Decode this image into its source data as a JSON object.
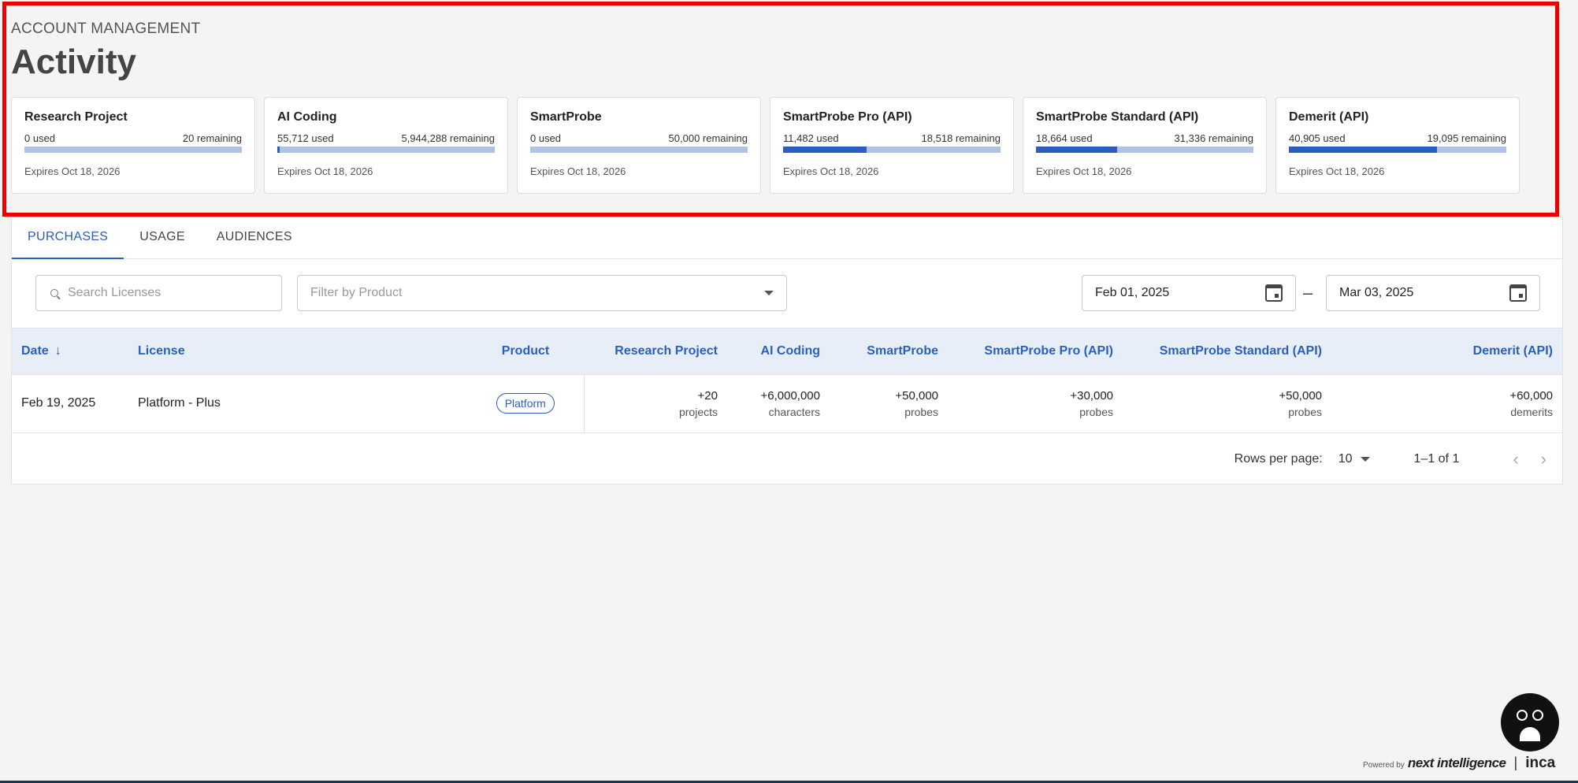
{
  "header": {
    "section": "ACCOUNT MANAGEMENT",
    "title": "Activity"
  },
  "cards": [
    {
      "title": "Research Project",
      "used": "0 used",
      "remaining": "20 remaining",
      "used_fraction": 0.0,
      "expiry": "Expires Oct 18, 2026"
    },
    {
      "title": "AI Coding",
      "used": "55,712 used",
      "remaining": "5,944,288 remaining",
      "used_fraction": 0.0093,
      "expiry": "Expires Oct 18, 2026"
    },
    {
      "title": "SmartProbe",
      "used": "0 used",
      "remaining": "50,000 remaining",
      "used_fraction": 0.0,
      "expiry": "Expires Oct 18, 2026"
    },
    {
      "title": "SmartProbe Pro (API)",
      "used": "11,482 used",
      "remaining": "18,518 remaining",
      "used_fraction": 0.3827,
      "expiry": "Expires Oct 18, 2026"
    },
    {
      "title": "SmartProbe Standard (API)",
      "used": "18,664 used",
      "remaining": "31,336 remaining",
      "used_fraction": 0.3733,
      "expiry": "Expires Oct 18, 2026"
    },
    {
      "title": "Demerit (API)",
      "used": "40,905 used",
      "remaining": "19,095 remaining",
      "used_fraction": 0.6818,
      "expiry": "Expires Oct 18, 2026"
    }
  ],
  "tabs": [
    "PURCHASES",
    "USAGE",
    "AUDIENCES"
  ],
  "filters": {
    "search_placeholder": "Search Licenses",
    "product_placeholder": "Filter by Product",
    "date_from": "Feb 01, 2025",
    "date_separator": "–",
    "date_to": "Mar 03, 2025"
  },
  "table": {
    "columns": [
      "Date",
      "License",
      "Product",
      "Research Project",
      "AI Coding",
      "SmartProbe",
      "SmartProbe Pro (API)",
      "SmartProbe Standard (API)",
      "Demerit (API)"
    ],
    "rows": [
      {
        "date": "Feb 19, 2025",
        "license": "Platform - Plus",
        "product": "Platform",
        "research_project": {
          "value": "+20",
          "unit": "projects"
        },
        "ai_coding": {
          "value": "+6,000,000",
          "unit": "characters"
        },
        "smartprobe": {
          "value": "+50,000",
          "unit": "probes"
        },
        "smartprobe_pro": {
          "value": "+30,000",
          "unit": "probes"
        },
        "smartprobe_standard": {
          "value": "+50,000",
          "unit": "probes"
        },
        "demerit": {
          "value": "+60,000",
          "unit": "demerits"
        }
      }
    ]
  },
  "pagination": {
    "rows_label": "Rows per page:",
    "rows_value": "10",
    "range": "1–1 of 1"
  },
  "footer": {
    "powered_by": "Powered by",
    "brand": "next intelligence",
    "separator": "|",
    "product": "inca"
  },
  "colors": {
    "accent": "#2a5fbf",
    "bar_track": "#aec3e6",
    "highlight": "#ee0000"
  }
}
